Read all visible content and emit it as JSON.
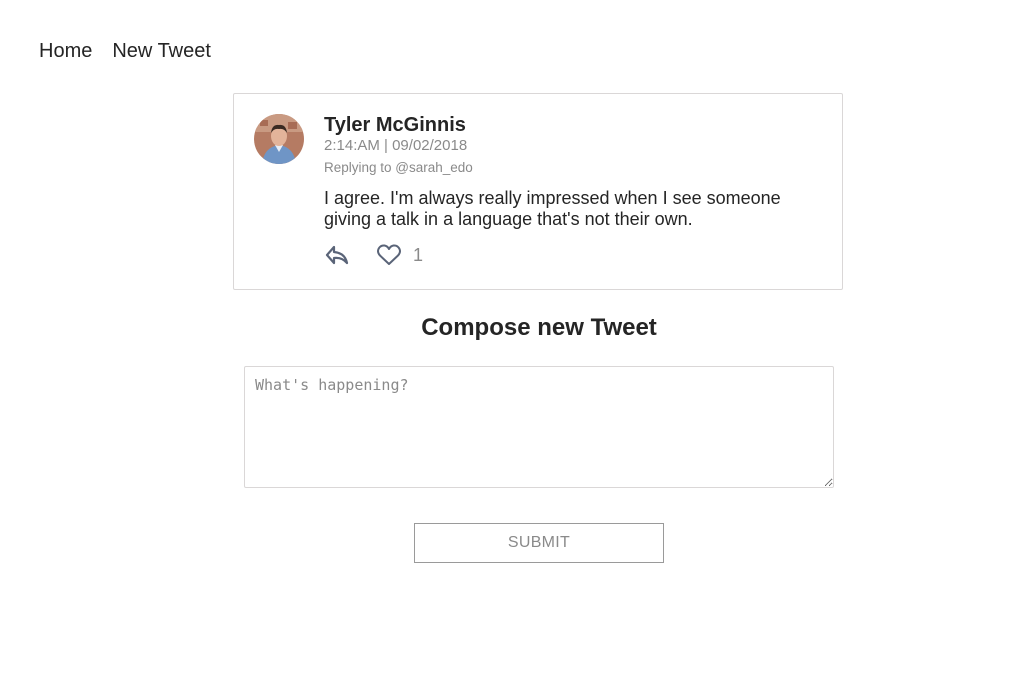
{
  "nav": {
    "home_label": "Home",
    "new_tweet_label": "New Tweet"
  },
  "tweet": {
    "author": "Tyler McGinnis",
    "timestamp": "2:14:AM | 09/02/2018",
    "replying_to": "Replying to @sarah_edo",
    "text": "I agree. I'm always really impressed when I see someone giving a talk in a language that's not their own.",
    "likes": "1",
    "reply_icon": "reply-arrow-icon",
    "like_icon": "heart-outline-icon"
  },
  "compose": {
    "title": "Compose new Tweet",
    "placeholder": "What's happening?",
    "value": "",
    "submit_label": "SUBMIT"
  },
  "colors": {
    "text": "#252525",
    "muted": "#8a8a8a",
    "border": "#dad7d7",
    "icon": "#5a6478"
  }
}
